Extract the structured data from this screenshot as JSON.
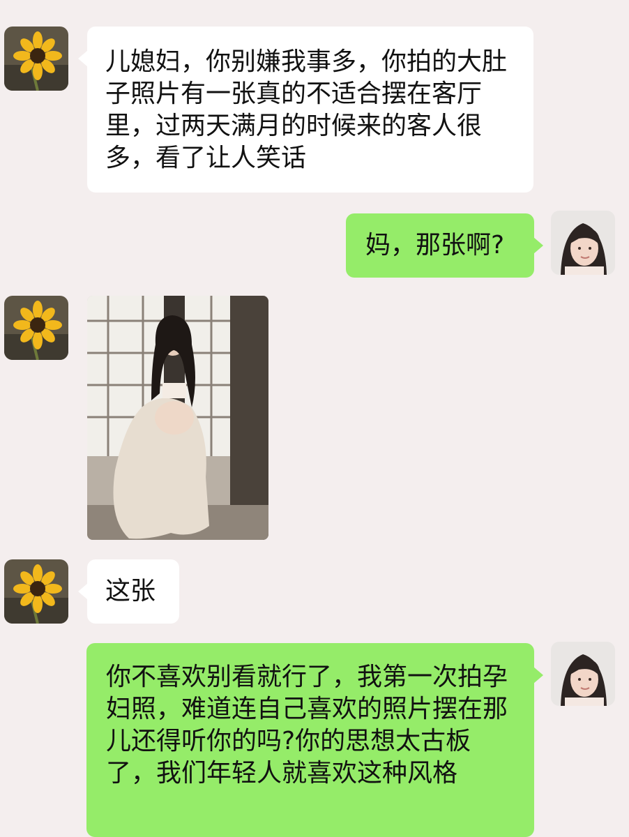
{
  "chat": {
    "messages": [
      {
        "side": "left",
        "sender": "mother-in-law",
        "type": "text",
        "text": "儿媳妇，你别嫌我事多，你拍的大肚子照片有一张真的不适合摆在客厅里，过两天满月的时候来的客人很多，看了让人笑话"
      },
      {
        "side": "right",
        "sender": "daughter-in-law",
        "type": "text",
        "text": "妈，那张啊?"
      },
      {
        "side": "left",
        "sender": "mother-in-law",
        "type": "image",
        "image_subject": "maternity-photo"
      },
      {
        "side": "left",
        "sender": "mother-in-law",
        "type": "text",
        "text": "这张"
      },
      {
        "side": "right",
        "sender": "daughter-in-law",
        "type": "text",
        "text": "你不喜欢别看就行了，我第一次拍孕妇照，难道连自己喜欢的照片摆在那儿还得听你的吗?你的思想太古板了，我们年轻人就喜欢这种风格"
      }
    ]
  },
  "avatars": {
    "left": "sunflower-icon",
    "right": "woman-portrait"
  },
  "colors": {
    "background": "#f4eeee",
    "left_bubble": "#ffffff",
    "right_bubble": "#95ec69",
    "text": "#111111"
  }
}
